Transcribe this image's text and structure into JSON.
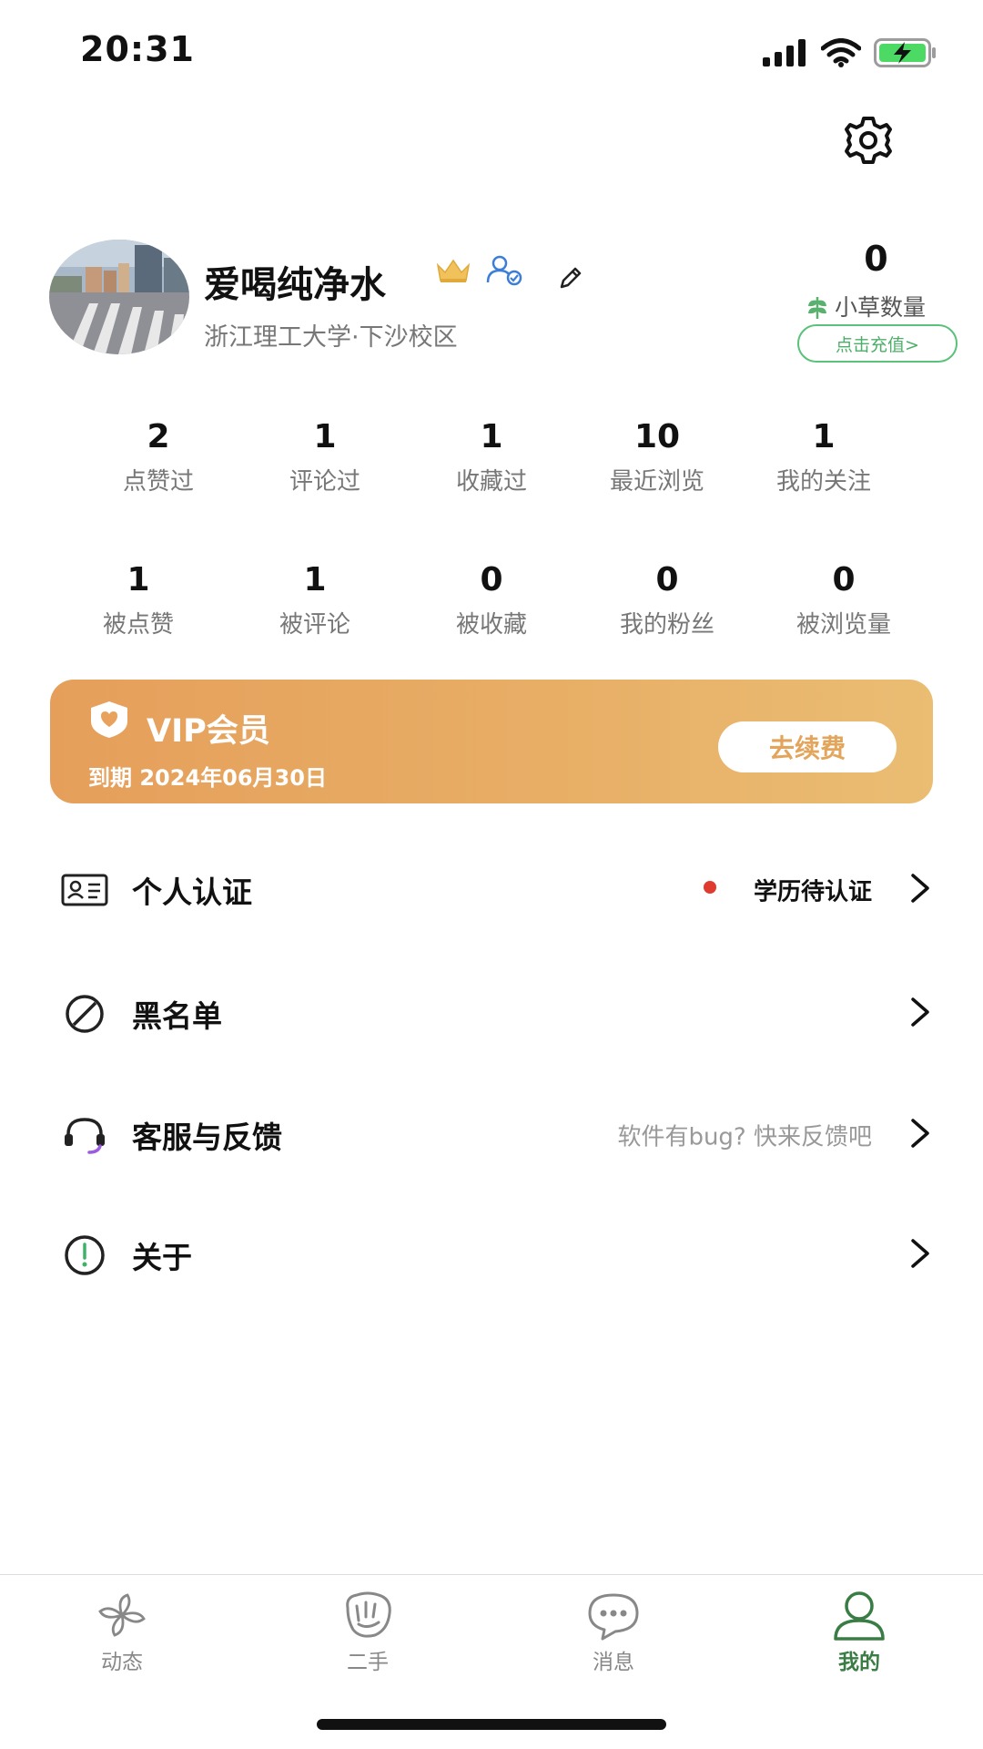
{
  "status_bar": {
    "time": "20:31"
  },
  "profile": {
    "username": "爱喝纯净水",
    "school": "浙江理工大学·下沙校区",
    "grass_count": "0",
    "grass_label": "小草数量",
    "recharge_label": "点击充值>"
  },
  "stats_row_1": [
    {
      "value": "2",
      "label": "点赞过"
    },
    {
      "value": "1",
      "label": "评论过"
    },
    {
      "value": "1",
      "label": "收藏过"
    },
    {
      "value": "10",
      "label": "最近浏览"
    },
    {
      "value": "1",
      "label": "我的关注"
    }
  ],
  "stats_row_2": [
    {
      "value": "1",
      "label": "被点赞"
    },
    {
      "value": "1",
      "label": "被评论"
    },
    {
      "value": "0",
      "label": "被收藏"
    },
    {
      "value": "0",
      "label": "我的粉丝"
    },
    {
      "value": "0",
      "label": "被浏览量"
    }
  ],
  "vip": {
    "title": "VIP会员",
    "expire": "到期 2024年06月30日",
    "renew_label": "去续费"
  },
  "menu": [
    {
      "label": "个人认证",
      "hint": "学历待认证",
      "icon": "id-card-icon"
    },
    {
      "label": "黑名单",
      "hint": "",
      "icon": "block-icon"
    },
    {
      "label": "客服与反馈",
      "hint": "软件有bug? 快来反馈吧",
      "icon": "headset-icon"
    },
    {
      "label": "关于",
      "hint": "",
      "icon": "info-icon"
    }
  ],
  "tabs": [
    {
      "label": "动态",
      "icon": "pinwheel-icon"
    },
    {
      "label": "二手",
      "icon": "hand-icon"
    },
    {
      "label": "消息",
      "icon": "chat-icon"
    },
    {
      "label": "我的",
      "icon": "user-icon"
    }
  ],
  "colors": {
    "accent_green": "#3a7d44",
    "vip_gradient_start": "#e59f5b",
    "vip_gradient_end": "#eabd73",
    "red_dot": "#e03b2f"
  }
}
